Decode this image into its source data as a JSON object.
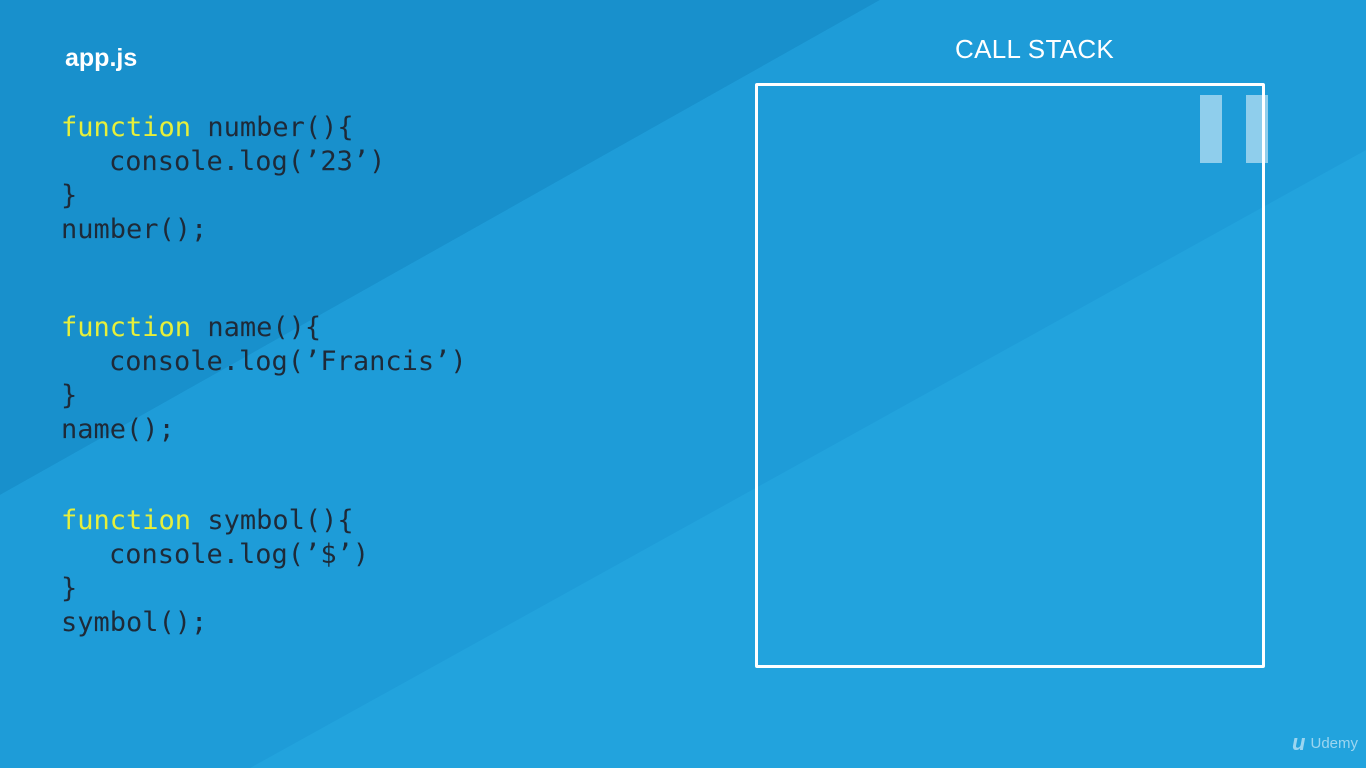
{
  "file": {
    "title": "app.js"
  },
  "code": {
    "blocks": [
      {
        "keyword": "function",
        "name": "number(){",
        "body": "console.log(’23’)",
        "close": "}",
        "call": "number();"
      },
      {
        "keyword": "function",
        "name": "name(){",
        "body": "console.log(’Francis’)",
        "close": "}",
        "call": "name();"
      },
      {
        "keyword": "function",
        "name": "symbol(){",
        "body": "console.log(’$’)",
        "close": "}",
        "call": "symbol();"
      }
    ]
  },
  "call_stack": {
    "title": "CALL STACK"
  },
  "player": {
    "pause_icon": "pause-icon"
  },
  "watermark": {
    "logo": "u",
    "text": "Udemy"
  },
  "colors": {
    "background": "#22a3dd",
    "background_dark": "#1890cc",
    "keyword": "#e6ef3b",
    "code_text": "#1e2a38",
    "box_border": "#ffffff"
  }
}
